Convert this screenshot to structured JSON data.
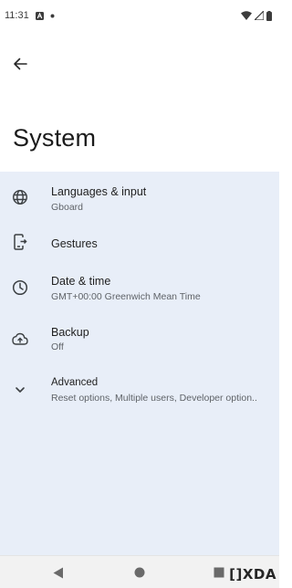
{
  "status_bar": {
    "time": "11:31",
    "icons": [
      "notification-a-icon",
      "dot-icon",
      "wifi-icon",
      "signal-icon",
      "battery-icon"
    ]
  },
  "app_bar": {
    "back_icon": "arrow-back-icon",
    "title": "System"
  },
  "items": [
    {
      "icon": "globe-icon",
      "title": "Languages & input",
      "subtitle": "Gboard"
    },
    {
      "icon": "gestures-phone-icon",
      "title": "Gestures",
      "subtitle": ""
    },
    {
      "icon": "clock-icon",
      "title": "Date & time",
      "subtitle": "GMT+00:00 Greenwich Mean Time"
    },
    {
      "icon": "cloud-backup-icon",
      "title": "Backup",
      "subtitle": "Off"
    },
    {
      "icon": "chevron-down-icon",
      "title": "Advanced",
      "subtitle": "Reset options, Multiple users, Developer option.."
    }
  ],
  "nav_bar": {
    "buttons": [
      "back-triangle-icon",
      "home-circle-icon",
      "recents-square-icon"
    ]
  },
  "watermark": "[]XDA",
  "colors": {
    "list_background": "#e8eef8",
    "text_primary": "#1f1f1f",
    "text_secondary": "#5f6368",
    "icon": "#3c4043"
  }
}
